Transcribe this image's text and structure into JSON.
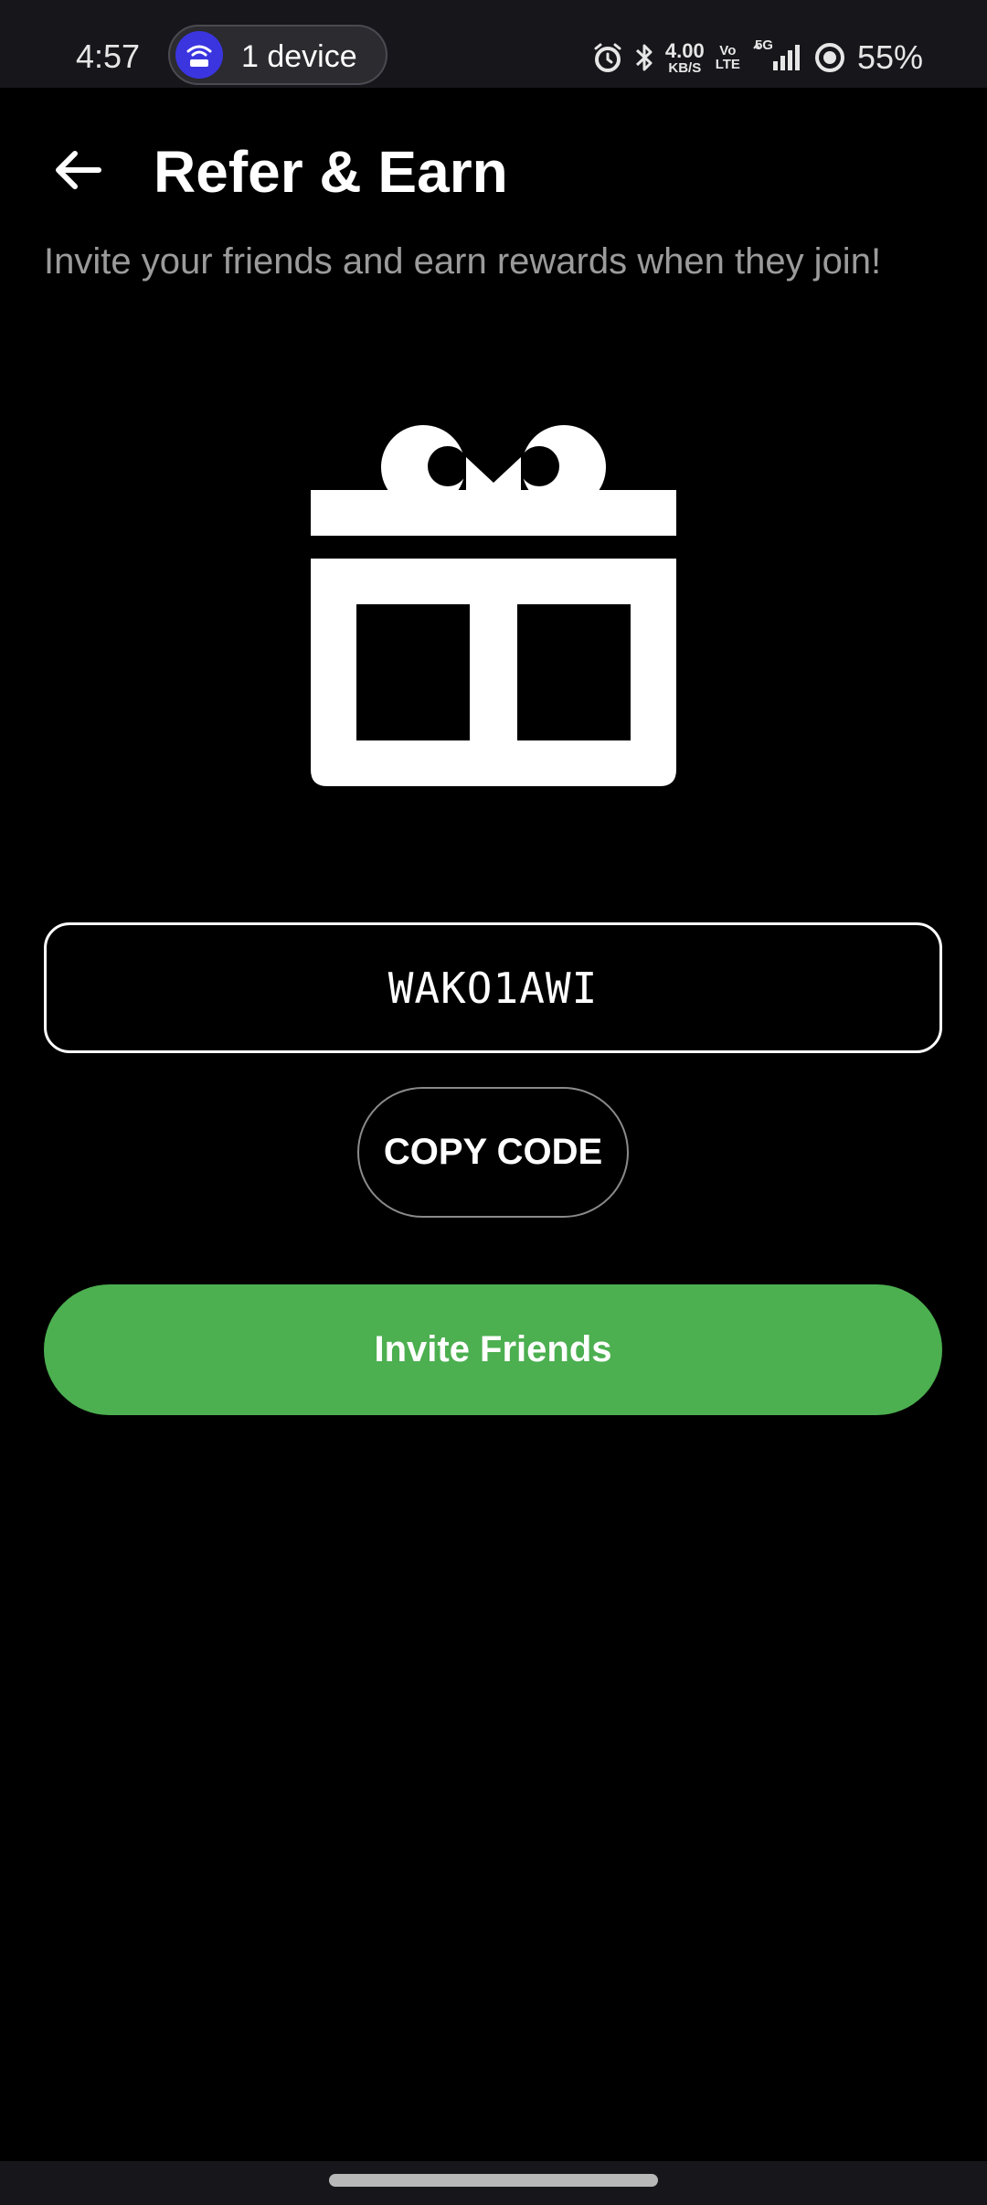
{
  "status_bar": {
    "time": "4:57",
    "hotspot_label": "1 device",
    "net_speed_value": "4.00",
    "net_speed_unit": "KB/S",
    "volte_top": "Vo",
    "volte_bottom": "LTE",
    "network_type": "5G",
    "battery": "55%",
    "icons": [
      "alarm-icon",
      "bluetooth-icon",
      "signal-icon",
      "battery-saver-icon"
    ]
  },
  "header": {
    "title": "Refer & Earn",
    "subtitle": "Invite your friends and earn rewards when they join!"
  },
  "referral": {
    "code": "WAKO1AWI",
    "copy_label": "COPY CODE",
    "invite_label": "Invite Friends"
  },
  "colors": {
    "background": "#000000",
    "accent_green": "#4caf50",
    "subtitle_gray": "#9b9b9b",
    "hotspot_blue": "#3b35e0"
  }
}
